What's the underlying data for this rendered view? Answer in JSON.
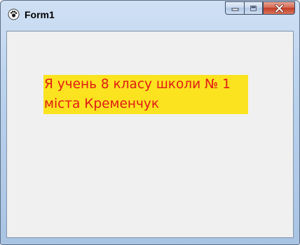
{
  "window": {
    "title": "Form1",
    "controls": {
      "minimize_icon": "minimize-icon",
      "maximize_icon": "maximize-icon",
      "close_icon": "close-icon"
    }
  },
  "form": {
    "label_lines": [
      "Я учень 8 класу школи № 1",
      "міста Кременчук"
    ]
  },
  "colors": {
    "label_background": "#fbe31f",
    "label_text": "#e11b16",
    "client_background": "#f0f0f0"
  }
}
